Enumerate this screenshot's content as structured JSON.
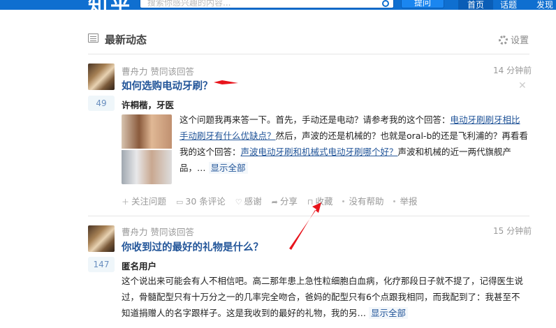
{
  "header": {
    "logo": "知乎",
    "search_placeholder": "搜索你感兴趣的内容...",
    "ask_label": "提问",
    "nav_home": "首页",
    "nav_topics": "话题",
    "nav_discover": "发现"
  },
  "feed": {
    "title": "最新动态",
    "settings_label": "设置"
  },
  "items": [
    {
      "actor": "曹舟力",
      "action": "赞同该回答",
      "time": "14 分钟前",
      "votes": "49",
      "question": "如何选购电动牙刷？",
      "author": "许桐楷，牙医",
      "text_1": "这个问题我再来答一下。首先，手动还是电动？请参考我的这个回答：",
      "link_1": "电动牙刷刷牙相比手动刷牙有什么优缺点？",
      "text_2": "然后，声波的还是机械的？也就是oral-b的还是飞利浦的？再看看我的这个回答：",
      "link_2": "声波电动牙刷和机械式电动牙刷哪个好？",
      "text_3": "声波和机械的近一两代旗舰产品，…",
      "show_all": "显示全部",
      "actions": {
        "follow": "关注问题",
        "comments": "30 条评论",
        "thanks": "感谢",
        "share": "分享",
        "collect": "收藏",
        "no_help": "没有帮助",
        "report": "举报"
      }
    },
    {
      "actor": "曹舟力",
      "action": "赞同该回答",
      "time": "15 分钟前",
      "votes": "147",
      "question": "你收到过的最好的礼物是什么？",
      "author": "匿名用户",
      "text_1": "这个说出来可能会有人不相信吧。高二那年患上急性粒细胞白血病，化疗那段日子就不提了，记得医生说过，骨髓配型只有十万分之一的几率完全吻合，爸妈的配型只有6个点跟我相同，而我配到了：我甚至不知道捐赠人的名字跟样子。这是我收到的最好的礼物，我的另…",
      "show_all": "显示全部"
    }
  ],
  "colors": {
    "brand_blue": "#0f6fd0",
    "link_blue": "#225599",
    "annotation_red": "#e8141c"
  }
}
